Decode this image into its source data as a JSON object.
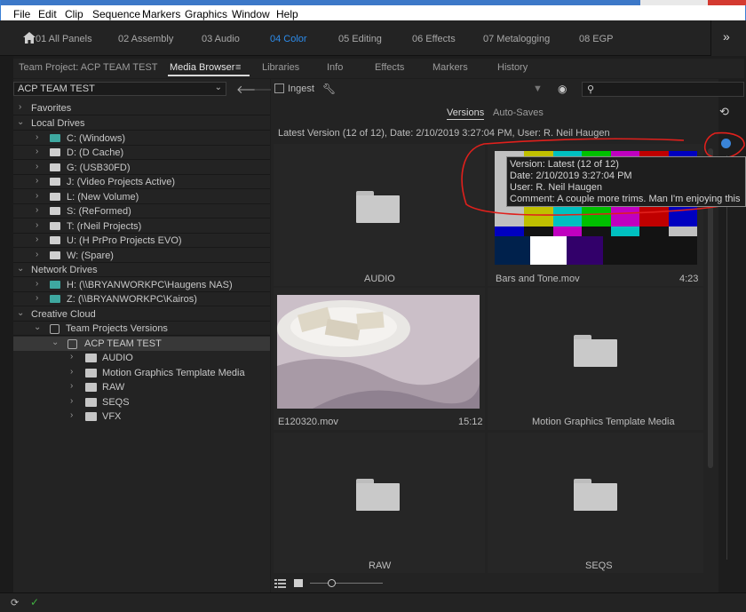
{
  "menubar": {
    "items": [
      "File",
      "Edit",
      "Clip",
      "Sequence",
      "Markers",
      "Graphics",
      "Window",
      "Help"
    ]
  },
  "workspaces": {
    "tabs": [
      "01 All Panels",
      "02 Assembly",
      "03 Audio",
      "04 Color",
      "05 Editing",
      "06 Effects",
      "07 Metalogging",
      "08 EGP"
    ],
    "active": "04 Color",
    "more": "»"
  },
  "panel_tabs": [
    "Team Project: ACP TEAM TEST",
    "Media Browser",
    "Libraries",
    "Info",
    "Effects",
    "Markers",
    "History"
  ],
  "panel_menu_icon": "≡",
  "project_dropdown": "ACP TEAM TEST",
  "toolbar": {
    "ingest_label": "Ingest"
  },
  "tree": {
    "favorites": "Favorites",
    "local_drives": "Local Drives",
    "local_items": [
      "C: (Windows)",
      "D: (D Cache)",
      "G: (USB30FD)",
      "J: (Video Projects Active)",
      "L: (New Volume)",
      "S: (ReFormed)",
      "T: (rNeil Projects)",
      "U: (H PrPro Projects EVO)",
      "W: (Spare)"
    ],
    "network_drives": "Network Drives",
    "network_items": [
      "H: (\\\\BRYANWORKPC\\Haugens NAS)",
      "Z: (\\\\BRYANWORKPC\\Kairos)"
    ],
    "creative_cloud": "Creative Cloud",
    "team_versions": "Team Projects Versions",
    "project": "ACP TEAM TEST",
    "folders": [
      "AUDIO",
      "Motion Graphics Template Media",
      "RAW",
      "SEQS",
      "VFX"
    ]
  },
  "version_tabs": {
    "versions": "Versions",
    "autosaves": "Auto-Saves"
  },
  "version_info": "Latest Version (12 of 12), Date: 2/10/2019 3:27:04 PM, User: R. Neil Haugen",
  "clips": [
    {
      "name": "AUDIO",
      "duration": ""
    },
    {
      "name": "Bars and Tone.mov",
      "duration": "4:23"
    },
    {
      "name": "E120320.mov",
      "duration": "15:12"
    },
    {
      "name": "Motion Graphics Template Media",
      "duration": ""
    },
    {
      "name": "RAW",
      "duration": ""
    },
    {
      "name": "SEQS",
      "duration": ""
    }
  ],
  "tooltip": {
    "line1": "Version: Latest (12 of 12)",
    "line2": "Date: 2/10/2019 3:27:04 PM",
    "line3": "User: R. Neil Haugen",
    "line4": "Comment: A couple more trims. Man I'm enjoying this ..."
  },
  "colors": {
    "accent": "#2d8ceb",
    "annotation": "#e0201c",
    "panel_bg": "#232323"
  }
}
